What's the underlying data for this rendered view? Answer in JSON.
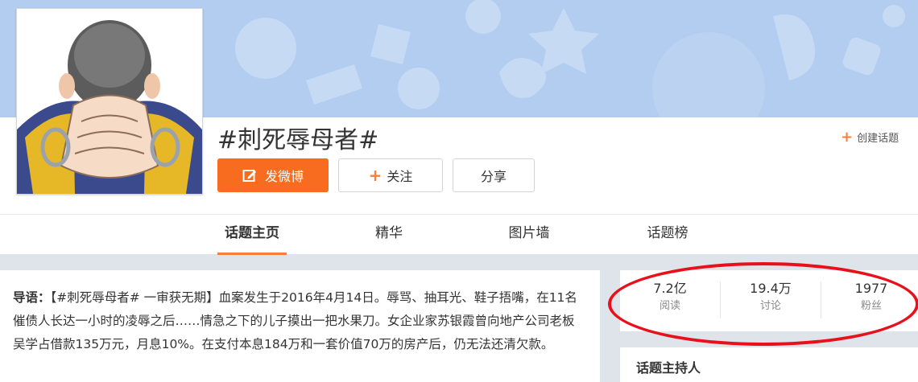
{
  "topic": {
    "title": "#刺死辱母者#",
    "create_label": "创建话题"
  },
  "actions": {
    "post_label": "发微博",
    "follow_label": "关注",
    "share_label": "分享"
  },
  "tabs": [
    {
      "label": "话题主页",
      "active": true
    },
    {
      "label": "精华",
      "active": false
    },
    {
      "label": "图片墙",
      "active": false
    },
    {
      "label": "话题榜",
      "active": false
    }
  ],
  "intro": {
    "label": "导语：",
    "text": "【#刺死辱母者# 一审获无期】血案发生于2016年4月14日。辱骂、抽耳光、鞋子捂嘴，在11名催债人长达一小时的凌辱之后……情急之下的儿子摸出一把水果刀。女企业家苏银霞曾向地产公司老板吴学占借款135万元，月息10%。在支付本息184万和一套价值70万的房产后，仍无法还清欠款。"
  },
  "stats": [
    {
      "value": "7.2亿",
      "label": "阅读"
    },
    {
      "value": "19.4万",
      "label": "讨论"
    },
    {
      "value": "1977",
      "label": "粉丝"
    }
  ],
  "host": {
    "title": "话题主持人"
  },
  "colors": {
    "accent": "#fa7d3c",
    "post_button": "#f76c1f",
    "annotation": "#e8101a",
    "banner": "#b2cdf0"
  },
  "icons": {
    "post": "edit-icon",
    "follow": "plus-icon",
    "create": "plus-icon"
  }
}
